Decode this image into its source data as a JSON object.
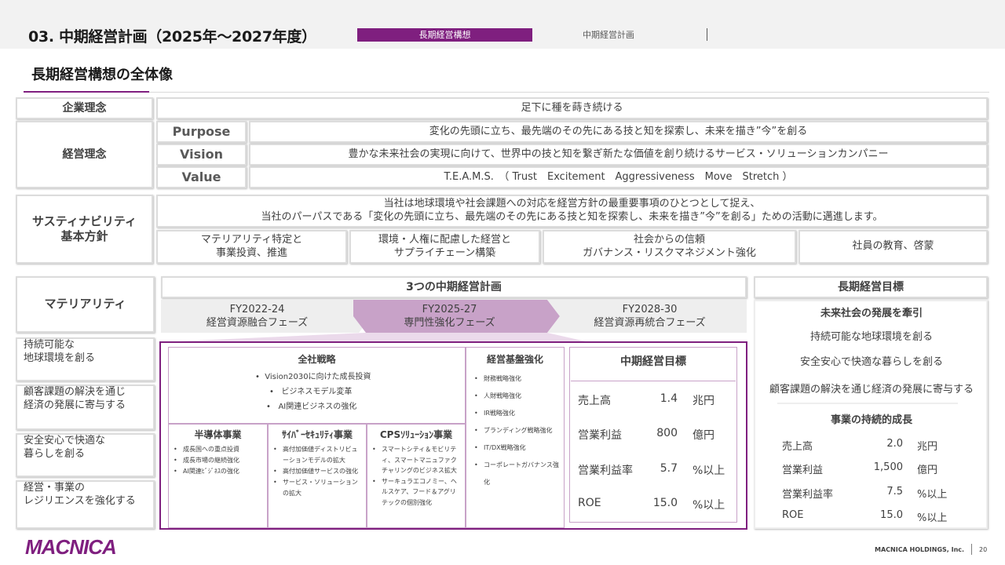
{
  "header": {
    "section_title": "03. 中期経営計画（2025年～2027年度）",
    "tab_active": "長期経営構想",
    "tab_next": "中期経営計画"
  },
  "page_title": "長期経営構想の全体像",
  "philosophy": {
    "corporate_label": "企業理念",
    "corporate_text": "足下に種を蒔き続ける",
    "management_label": "経営理念",
    "rows": [
      {
        "label": "Purpose",
        "text": "変化の先頭に立ち、最先端のその先にある技と知を探索し、未来を描き”今”を創る"
      },
      {
        "label": "Vision",
        "text": "豊かな未来社会の実現に向けて、世界中の技と知を繋ぎ新たな価値を創り続けるサービス・ソリューションカンパニー"
      },
      {
        "label": "Value",
        "text": "T.E.A.M.S.　（ Trust　Excitement　Aggressiveness　Move　Stretch ）"
      }
    ]
  },
  "sustainability": {
    "label_line1": "サスティナビリティ",
    "label_line2": "基本方針",
    "policy_line1": "当社は地球環境や社会課題への対応を経営方針の最重要事項のひとつとして捉え、",
    "policy_line2": "当社のパーパスである「変化の先頭に立ち、最先端のその先にある技と知を探索し、未来を描き”今”を創る」ための活動に邁進します。",
    "items": [
      {
        "line1": "マテリアリティ特定と",
        "line2": "事業投資、推進"
      },
      {
        "line1": "環境・人権に配慮した経営と",
        "line2": "サプライチェーン構築"
      },
      {
        "line1": "社会からの信頼",
        "line2": "ガバナンス・リスクマネジメント強化"
      },
      {
        "line1": "社員の教育、啓蒙",
        "line2": ""
      }
    ]
  },
  "materiality": {
    "label": "マテリアリティ",
    "items": [
      {
        "line1": "持続可能な",
        "line2": "地球環境を創る"
      },
      {
        "line1": "顧客課題の解決を通じ",
        "line2": "経済の発展に寄与する"
      },
      {
        "line1": "安全安心で快適な",
        "line2": "暮らしを創る"
      },
      {
        "line1": "経営・事業の",
        "line2": "レジリエンスを強化する"
      }
    ]
  },
  "mid_plans": {
    "title": "3つの中期経営計画",
    "phases": [
      {
        "fy": "FY2022-24",
        "name": "経営資源融合フェーズ"
      },
      {
        "fy": "FY2025-27",
        "name": "専門性強化フェーズ"
      },
      {
        "fy": "FY2028-30",
        "name": "経営資源再統合フェーズ"
      }
    ]
  },
  "strategy": {
    "corp_title": "全社戦略",
    "corp_items": [
      "Vision2030に向けた成長投資",
      "ビジネスモデル変革",
      "AI関連ビジネスの強化"
    ],
    "segments": [
      {
        "title": "半導体事業",
        "items": [
          "成長国への重点投資",
          "成長市場の継続強化",
          "AI関連ﾋﾞｼﾞﾈｽの強化"
        ]
      },
      {
        "title": "ｻｲﾊﾞｰｾｷｭﾘﾃｨ事業",
        "items": [
          "高付加価値ディストリビューションモデルの拡大",
          "高付加価値サービスの強化",
          "サービス・ソリューションの拡大"
        ]
      },
      {
        "title": "CPSｿﾘｭｰｼｮﾝ事業",
        "items": [
          "スマートシティ＆モビリティ、スマートマニュファクチャリングのビジネス拡大",
          "サーキュラエコノミー、ヘルスケア、フード＆アグリテックの個別強化"
        ]
      }
    ],
    "base_title": "経営基盤強化",
    "base_items": [
      "財務戦略強化",
      "人財戦略強化",
      "IR戦略強化",
      "ブランディング戦略強化",
      "IT/DX戦略強化",
      "コーポレートガバナンス強化"
    ]
  },
  "mid_targets": {
    "title": "中期経営目標",
    "rows": [
      {
        "label": "売上高",
        "value": "1.4",
        "unit": "兆円"
      },
      {
        "label": "営業利益",
        "value": "800",
        "unit": "億円"
      },
      {
        "label": "営業利益率",
        "value": "5.7",
        "unit": "%以上"
      },
      {
        "label": "ROE",
        "value": "15.0",
        "unit": "%以上"
      }
    ]
  },
  "long_term": {
    "title": "長期経営目標",
    "subtitle": "未来社会の発展を牽引",
    "items": [
      "持続可能な地球環境を創る",
      "安全安心で快適な暮らしを創る",
      "顧客課題の解決を通じ経済の発展に寄与する"
    ],
    "growth_title": "事業の持続的成長",
    "rows": [
      {
        "label": "売上高",
        "value": "2.0",
        "unit": "兆円"
      },
      {
        "label": "営業利益",
        "value": "1,500",
        "unit": "億円"
      },
      {
        "label": "営業利益率",
        "value": "7.5",
        "unit": "%以上"
      },
      {
        "label": "ROE",
        "value": "15.0",
        "unit": "%以上"
      }
    ]
  },
  "footer": {
    "logo": "MACNICA",
    "company": "MACNICA HOLDINGS, Inc.",
    "page": "20"
  },
  "colors": {
    "accent": "#7f1f7f",
    "arrow_active": "#c8a2c8",
    "arrow_inactive": "#eeeeee"
  }
}
